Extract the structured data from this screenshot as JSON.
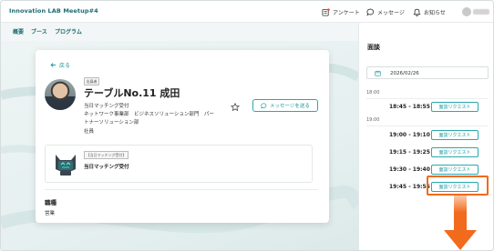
{
  "header": {
    "app_title": "Innovation LAB Meetup#4",
    "survey": "アンケート",
    "message": "メッセージ",
    "notice": "お知らせ"
  },
  "nav": {
    "tabs": [
      "概要",
      "ブース",
      "プログラム"
    ]
  },
  "profile": {
    "back_label": "戻る",
    "role_badge": "出展者",
    "name": "テーブルNo.11 成田",
    "line1": "当日マッチング受付",
    "line2": "ネットワーク事業部　ビジネスソリューション部門　パー",
    "line3": "トナーソリューション部",
    "line4": "社員",
    "message_button": "メッセージを送る"
  },
  "booth": {
    "badge": "【当日マッチング受付】",
    "name": "当日マッチング受付"
  },
  "job": {
    "label": "職種",
    "value": "営業"
  },
  "meeting_panel": {
    "title": "面談",
    "date": "2026/02/26",
    "hour_18": "18:00",
    "hour_19": "19:00",
    "slots": [
      {
        "time": "18:45 - 18:55",
        "button": "面談リクエスト"
      },
      {
        "time": "19:00 - 19:10",
        "button": "面談リクエスト"
      },
      {
        "time": "19:15 - 19:25",
        "button": "面談リクエスト"
      },
      {
        "time": "19:30 - 19:40",
        "button": "面談リクエスト"
      },
      {
        "time": "19:45 - 19:55",
        "button": "面談リクエスト"
      }
    ]
  },
  "colors": {
    "accent": "#1b9aa0",
    "highlight": "#f26a1b"
  }
}
